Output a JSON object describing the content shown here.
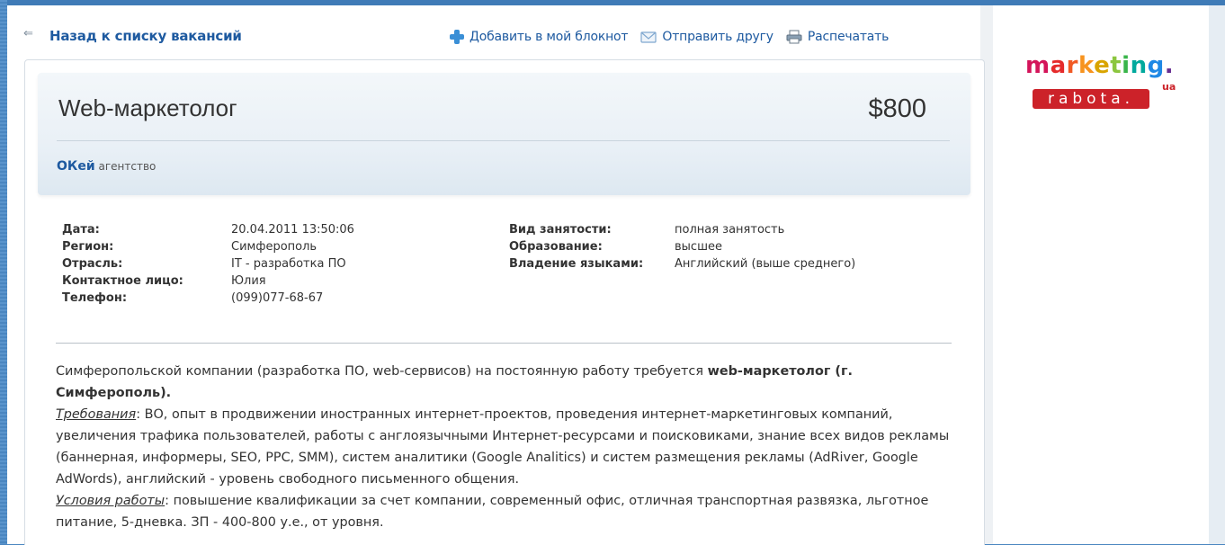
{
  "nav": {
    "back_arrow": "⇐",
    "back_label": "Назад к списку вакансий"
  },
  "actions": {
    "add_label": "Добавить в мой блокнот",
    "send_label": "Отправить другу",
    "print_label": "Распечатать"
  },
  "job": {
    "title": "Web-маркетолог",
    "salary": "$800",
    "company_name": "ОКей",
    "company_type": "агентство"
  },
  "details_left": [
    {
      "label": "Дата:",
      "value": "20.04.2011 13:50:06"
    },
    {
      "label": "Регион:",
      "value": "Симферополь"
    },
    {
      "label": "Отрасль:",
      "value": "IT - разработка ПО"
    },
    {
      "label": "Контактное лицо:",
      "value": "Юлия"
    },
    {
      "label": "Телефон:",
      "value": "(099)077-68-67"
    }
  ],
  "details_right": [
    {
      "label": "Вид занятости:",
      "value": "полная занятость"
    },
    {
      "label": "Образование:",
      "value": "высшее"
    },
    {
      "label": "Владение языками:",
      "value": "Английский (выше среднего)"
    }
  ],
  "description": {
    "intro": "Симферопольской компании (разработка ПО, web-сервисов) на постоянную работу требуется ",
    "intro_bold": "web-маркетолог (г. Симферополь).",
    "req_label": "Требования",
    "req_text": ": ВО, опыт в продвижении иностранных интернет-проектов, проведения интернет-маркетинговых компаний, увеличения трафика пользователей, работы с англоязычными Интернет-ресурсами и поисковиками, знание всех видов рекламы (баннерная, информеры, SEO, PPC, SMM), систем аналитики (Google Analitics) и систем размещения рекламы (AdRiver, Google AdWords), английский - уровень свободного письменного общения.",
    "cond_label": "Условия работы",
    "cond_text": ": повышение квалификации за счет компании, современный офис, отличная транспортная развязка, льготное питание, 5-дневка. ЗП - 400-800 у.е., от уровня."
  },
  "logo": {
    "top_text": "marketing.",
    "bottom_text": "rabota.",
    "ua": "ua"
  },
  "colors": {
    "link": "#1e5aa0",
    "logo_red": "#cc2229"
  }
}
